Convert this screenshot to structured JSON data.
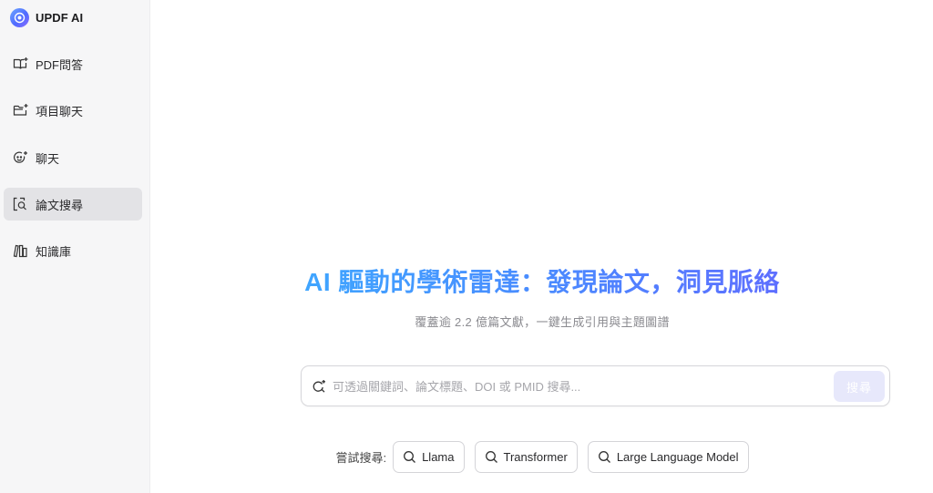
{
  "brand": {
    "name": "UPDF AI"
  },
  "sidebar": {
    "items": [
      {
        "label": "PDF問答",
        "icon": "book-open-icon"
      },
      {
        "label": "項目聊天",
        "icon": "folder-plus-icon"
      },
      {
        "label": "聊天",
        "icon": "smile-chat-icon"
      },
      {
        "label": "論文搜尋",
        "icon": "doc-search-icon",
        "active": true
      },
      {
        "label": "知識庫",
        "icon": "library-icon"
      }
    ]
  },
  "main": {
    "title": "AI 驅動的學術雷達：發現論文，洞見脈絡",
    "subtitle": "覆蓋逾 2.2 億篇文獻，一鍵生成引用與主題圖譜",
    "search": {
      "placeholder": "可透過關鍵詞、論文標題、DOI 或 PMID 搜尋...",
      "value": "",
      "button_label": "搜尋"
    },
    "suggestions": {
      "label": "嘗試搜尋:",
      "chips": [
        "Llama",
        "Transformer",
        "Large Language Model"
      ]
    }
  },
  "colors": {
    "title_gradient": [
      "#38b6ff",
      "#4a8bff",
      "#6a5cff"
    ],
    "button_bg": "#e7e8fb",
    "sidebar_active": "#e3e3e6"
  }
}
